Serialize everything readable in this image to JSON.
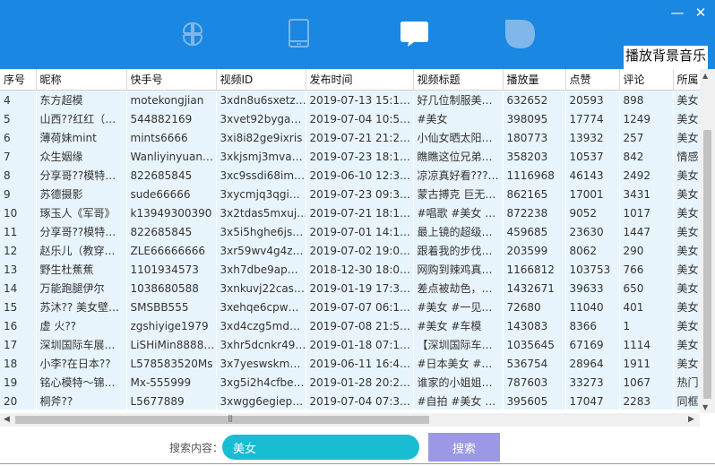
{
  "window": {
    "close_glyph": "✕",
    "minimize_glyph": "—"
  },
  "nav": [
    {
      "icon": "apps-grid-icon"
    },
    {
      "icon": "phone-icon"
    },
    {
      "icon": "chat-icon"
    },
    {
      "icon": "leaf-icon"
    }
  ],
  "music_label": "播放背景音乐",
  "table": {
    "columns": [
      "序号",
      "昵称",
      "快手号",
      "视频ID",
      "发布时间",
      "视频标题",
      "播放量",
      "点赞",
      "评论",
      "所属"
    ],
    "rows": [
      [
        "4",
        "东方超模",
        "motekongjian",
        "3xdn8u6sxetz…",
        "2019-07-13 15:1…",
        "好几位制服美…",
        "632652",
        "20593",
        "898",
        "美女"
      ],
      [
        "5",
        "山西??红红（…",
        "544882169",
        "3xvet92byga…",
        "2019-07-04 10:5…",
        "#美女",
        "398095",
        "17774",
        "1249",
        "美女"
      ],
      [
        "6",
        "薄荷妹mint",
        "mints6666",
        "3xi8i82ge9ixris",
        "2019-07-21 21:2…",
        "小仙女晒太阳…",
        "180773",
        "13932",
        "257",
        "美女"
      ],
      [
        "7",
        "众生姻缘",
        "Wanliyinyuan…",
        "3xkjsmj3mva…",
        "2019-07-23 18:1…",
        "瞧瞧这位兄弟…",
        "358203",
        "10537",
        "842",
        "情感"
      ],
      [
        "8",
        "分享哥??模特…",
        "822685845",
        "3xc9ssdi68im…",
        "2019-06-10 12:3…",
        "凉凉真好看???…",
        "1116968",
        "46143",
        "2492",
        "美女"
      ],
      [
        "9",
        "苏德摄影",
        "sude66666",
        "3xycmjq3qgi…",
        "2019-07-23 09:3…",
        "蒙古搏克 巨无…",
        "862165",
        "17001",
        "3431",
        "美女"
      ],
      [
        "10",
        "琢玉人《军哥》",
        "k13949300390",
        "3x2tdas5mxuj…",
        "2019-07-21 18:1…",
        "#唱歌 #美女 …",
        "872238",
        "9052",
        "1017",
        "美女"
      ],
      [
        "11",
        "分享哥??模特…",
        "822685845",
        "3x5i5hghe6js…",
        "2019-07-01 14:1…",
        "最上镜的超级…",
        "459685",
        "23630",
        "1447",
        "美女"
      ],
      [
        "12",
        "赵乐儿（教穿…",
        "ZLE66666666",
        "3xr59wv4g4z…",
        "2019-07-02 19:0…",
        "跟着我的步伐…",
        "203599",
        "8062",
        "290",
        "美女"
      ],
      [
        "13",
        "野生杜蕉蕉",
        "1101934573",
        "3xh7dbe9ap…",
        "2018-12-30 18:0…",
        "网购到辣鸡真…",
        "1166812",
        "103753",
        "766",
        "美女"
      ],
      [
        "14",
        "万能跑腿伊尔",
        "1038680588",
        "3xnkuvj22cas…",
        "2019-01-19 17:3…",
        "差点被劫色，…",
        "1432671",
        "39633",
        "650",
        "美女"
      ],
      [
        "15",
        "苏沐?? 美女壁…",
        "SMSBB555",
        "3xehqe6cpw…",
        "2019-07-07 06:1…",
        "#美女 #一见…",
        "72680",
        "11040",
        "401",
        "美女"
      ],
      [
        "16",
        "虚  火??",
        "zgshiyige1979",
        "3xd4czg5md…",
        "2019-07-08 21:5…",
        "#美女 #车模",
        "143083",
        "8366",
        "1",
        "美女"
      ],
      [
        "17",
        "深圳国际车展…",
        "LiSHiMin8888…",
        "3xhr5dcnkr49…",
        "2019-01-18 07:1…",
        "【深圳国际车…",
        "1035645",
        "67169",
        "1114",
        "美女"
      ],
      [
        "18",
        "小李?在日本??",
        "L578583520Ms",
        "3x7yeswskm…",
        "2019-06-11 16:4…",
        "#日本美女 #…",
        "536754",
        "28964",
        "1911",
        "美女"
      ],
      [
        "19",
        "铭心模特～锦…",
        "Mx-555999",
        "3xg5i2h4cfbe…",
        "2019-01-28 20:2…",
        "谁家的小姐姐…",
        "787603",
        "33273",
        "1067",
        "热门"
      ],
      [
        "20",
        "桐斧??",
        "L5677889",
        "3xwgg6egiep…",
        "2019-07-04 07:3…",
        "#自拍 #美女 …",
        "395605",
        "17047",
        "2283",
        "同框"
      ]
    ]
  },
  "search": {
    "label": "搜索内容：",
    "value": "美女",
    "button": "搜索"
  }
}
